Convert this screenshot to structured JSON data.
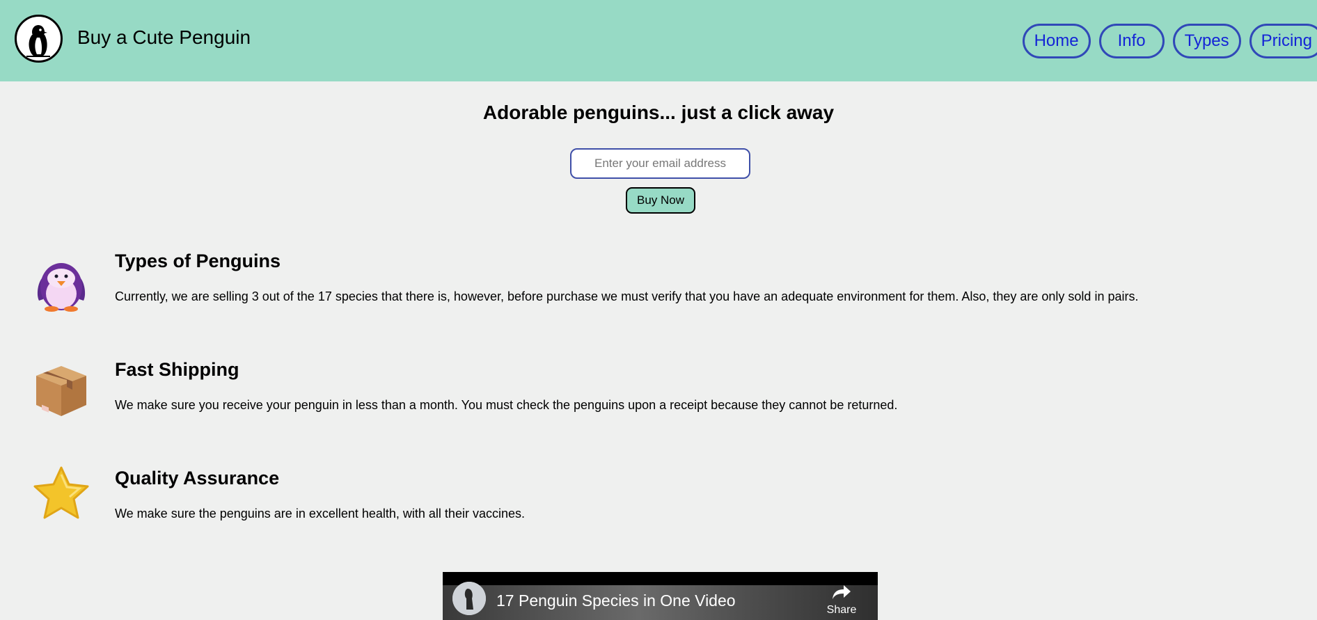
{
  "header": {
    "brand": "Buy a Cute Penguin",
    "nav": [
      {
        "label": "Home"
      },
      {
        "label": "Info"
      },
      {
        "label": "Types"
      },
      {
        "label": "Pricing"
      }
    ]
  },
  "hero": {
    "title": "Adorable penguins... just a click away",
    "email_placeholder": "Enter your email address",
    "email_value": "",
    "buy_label": "Buy Now"
  },
  "features": [
    {
      "icon": "penguin-icon",
      "title": "Types of Penguins",
      "text": "Currently, we are selling 3 out of the 17 species that there is, however, before purchase we must verify that you have an adequate environment for them. Also, they are only sold in pairs."
    },
    {
      "icon": "box-icon",
      "title": "Fast Shipping",
      "text": "We make sure you receive your penguin in less than a month. You must check the penguins upon a receipt because they cannot be returned."
    },
    {
      "icon": "star-icon",
      "title": "Quality Assurance",
      "text": "We make sure the penguins are in excellent health, with all their vaccines."
    }
  ],
  "video": {
    "title": "17 Penguin Species in One Video",
    "share_label": "Share"
  },
  "colors": {
    "header_bg": "#97dac5",
    "page_bg": "#eff0ef",
    "nav_border": "#3048b8",
    "nav_text": "#1424d6"
  }
}
